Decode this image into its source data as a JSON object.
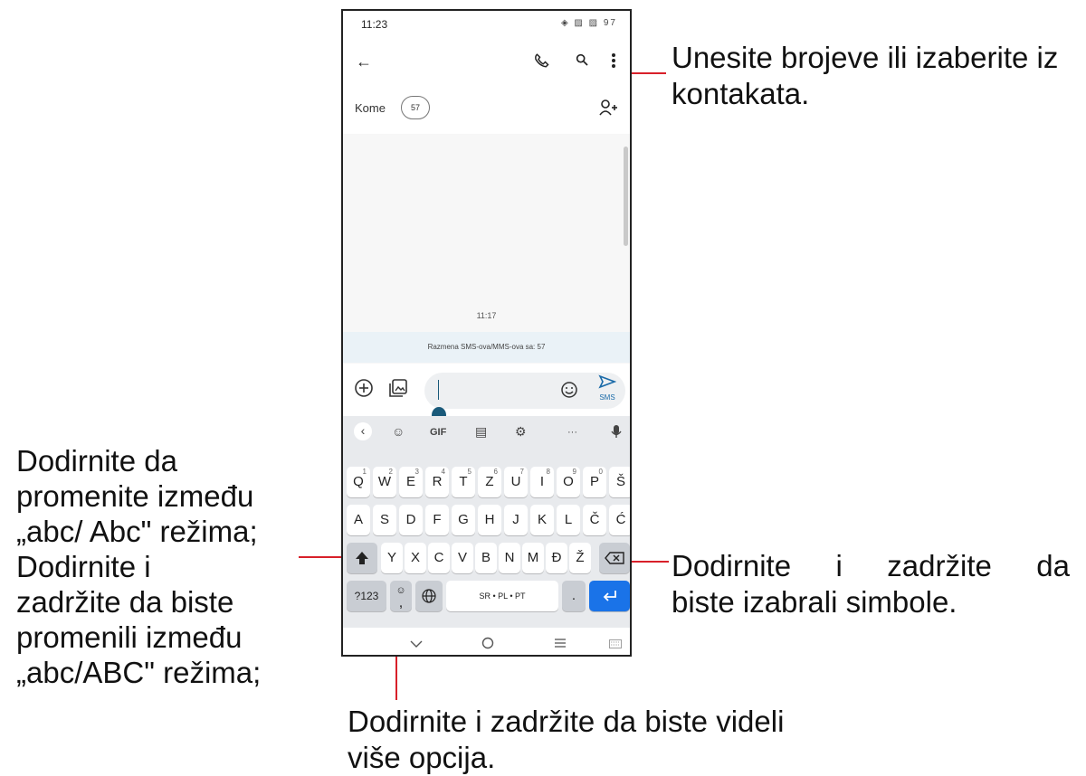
{
  "status": {
    "time": "11:23",
    "icons": "◈ ▨ ▨ 97",
    "battery": "97"
  },
  "toolbar": {
    "back_icon": "←",
    "call_icon": "call-icon",
    "search_icon": "search-icon",
    "more_icon": "more-vert-icon"
  },
  "recipients": {
    "label": "Kome",
    "chip": "57"
  },
  "conversation": {
    "timestamp": "11:17",
    "info": "Razmena SMS-ova/MMS-ova sa: 57"
  },
  "compose": {
    "send_label": "SMS"
  },
  "keyboard": {
    "toolbar": [
      "‹",
      "☺",
      "GIF",
      "▤",
      "⚙",
      "···",
      "🎤"
    ],
    "row1": [
      {
        "k": "Q",
        "s": "1"
      },
      {
        "k": "W",
        "s": "2"
      },
      {
        "k": "E",
        "s": "3"
      },
      {
        "k": "R",
        "s": "4"
      },
      {
        "k": "T",
        "s": "5"
      },
      {
        "k": "Z",
        "s": "6"
      },
      {
        "k": "U",
        "s": "7"
      },
      {
        "k": "I",
        "s": "8"
      },
      {
        "k": "O",
        "s": "9"
      },
      {
        "k": "P",
        "s": "0"
      },
      {
        "k": "Š",
        "s": ""
      }
    ],
    "row2": [
      "A",
      "S",
      "D",
      "F",
      "G",
      "H",
      "J",
      "K",
      "L",
      "Č",
      "Ć"
    ],
    "row3": [
      "Y",
      "X",
      "C",
      "V",
      "B",
      "N",
      "M",
      "Đ",
      "Ž"
    ],
    "sym_label": "?123",
    "comma": ",",
    "space_label": "SR • PL • PT",
    "period": "."
  },
  "annotations": {
    "top_right": "Unesite brojeve ili izaberite iz kontakata.",
    "left": [
      "Dodirnite da",
      "promenite između",
      "„abc/ Abc\" režima;",
      "Dodirnite i",
      "zadržite da biste",
      "promenili između",
      "„abc/ABC\" režima;"
    ],
    "right_mid": [
      "Dodirnite i zadržite da",
      "biste izabrali simbole."
    ],
    "bottom": [
      "Dodirnite i zadržite da biste videli",
      "više opcija."
    ]
  }
}
